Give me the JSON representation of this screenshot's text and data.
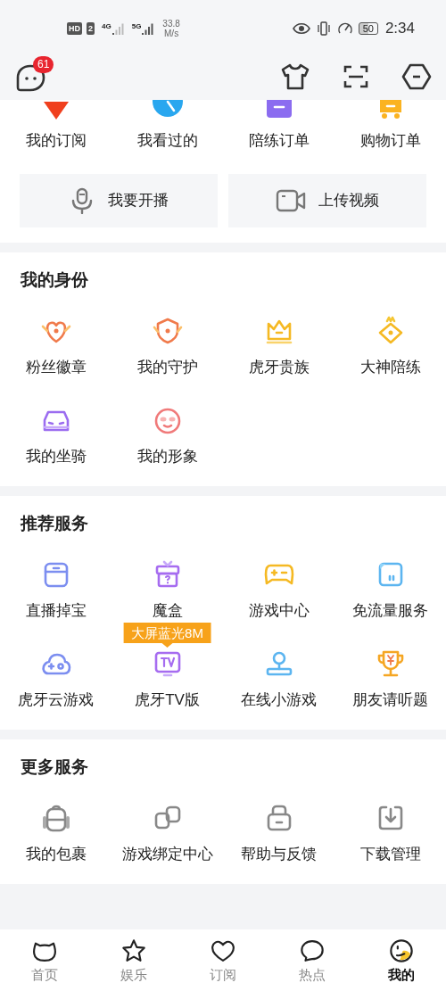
{
  "status_bar": {
    "network_badges": [
      "HD",
      "2"
    ],
    "signals": [
      "4G",
      "5G"
    ],
    "speed": [
      "33.8",
      "M/s"
    ],
    "battery": "50",
    "time": "2:34"
  },
  "top_bar": {
    "message_badge": "61"
  },
  "orders": [
    {
      "label": "我的订阅"
    },
    {
      "label": "我看过的"
    },
    {
      "label": "陪练订单"
    },
    {
      "label": "购物订单"
    }
  ],
  "actions": [
    {
      "label": "我要开播"
    },
    {
      "label": "上传视频"
    }
  ],
  "sections": [
    {
      "title": "我的身份",
      "items": [
        {
          "label": "粉丝徽章"
        },
        {
          "label": "我的守护"
        },
        {
          "label": "虎牙贵族"
        },
        {
          "label": "大神陪练"
        },
        {
          "label": "我的坐骑"
        },
        {
          "label": "我的形象"
        }
      ]
    },
    {
      "title": "推荐服务",
      "items": [
        {
          "label": "直播掉宝"
        },
        {
          "label": "魔盒"
        },
        {
          "label": "游戏中心"
        },
        {
          "label": "免流量服务"
        },
        {
          "label": "虎牙云游戏"
        },
        {
          "label": "虎牙TV版",
          "badge": "大屏蓝光8M"
        },
        {
          "label": "在线小游戏"
        },
        {
          "label": "朋友请听题"
        }
      ]
    },
    {
      "title": "更多服务",
      "items": [
        {
          "label": "我的包裹"
        },
        {
          "label": "游戏绑定中心"
        },
        {
          "label": "帮助与反馈"
        },
        {
          "label": "下载管理"
        }
      ]
    }
  ],
  "bottom_nav": [
    {
      "label": "首页",
      "selected": false
    },
    {
      "label": "娱乐",
      "selected": false
    },
    {
      "label": "订阅",
      "selected": false
    },
    {
      "label": "热点",
      "selected": false
    },
    {
      "label": "我的",
      "selected": true
    }
  ]
}
